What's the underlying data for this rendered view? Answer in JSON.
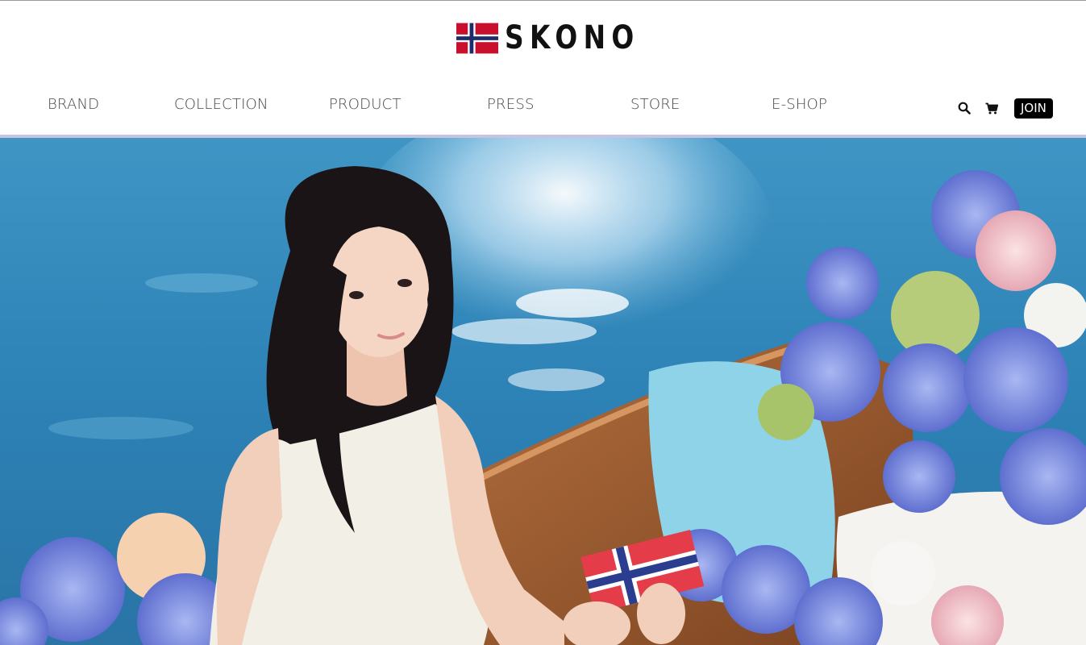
{
  "brand": {
    "logo_text": "SKONO",
    "flag_icon": "norway-flag-icon",
    "colors": {
      "flag_red": "#c8102e",
      "flag_blue": "#1f2c6b",
      "flag_white": "#ffffff"
    }
  },
  "nav": {
    "items": [
      {
        "label": "BRAND"
      },
      {
        "label": "COLLECTION"
      },
      {
        "label": "PRODUCT"
      },
      {
        "label": "PRESS"
      },
      {
        "label": "STORE"
      },
      {
        "label": "E-SHOP"
      }
    ]
  },
  "tools": {
    "search_icon": "search-icon",
    "cart_icon": "cart-icon",
    "join_label": "JOIN"
  },
  "colors": {
    "accent_bar": "#c9c3e2",
    "join_bg": "#000000",
    "nav_text": "#444444"
  }
}
